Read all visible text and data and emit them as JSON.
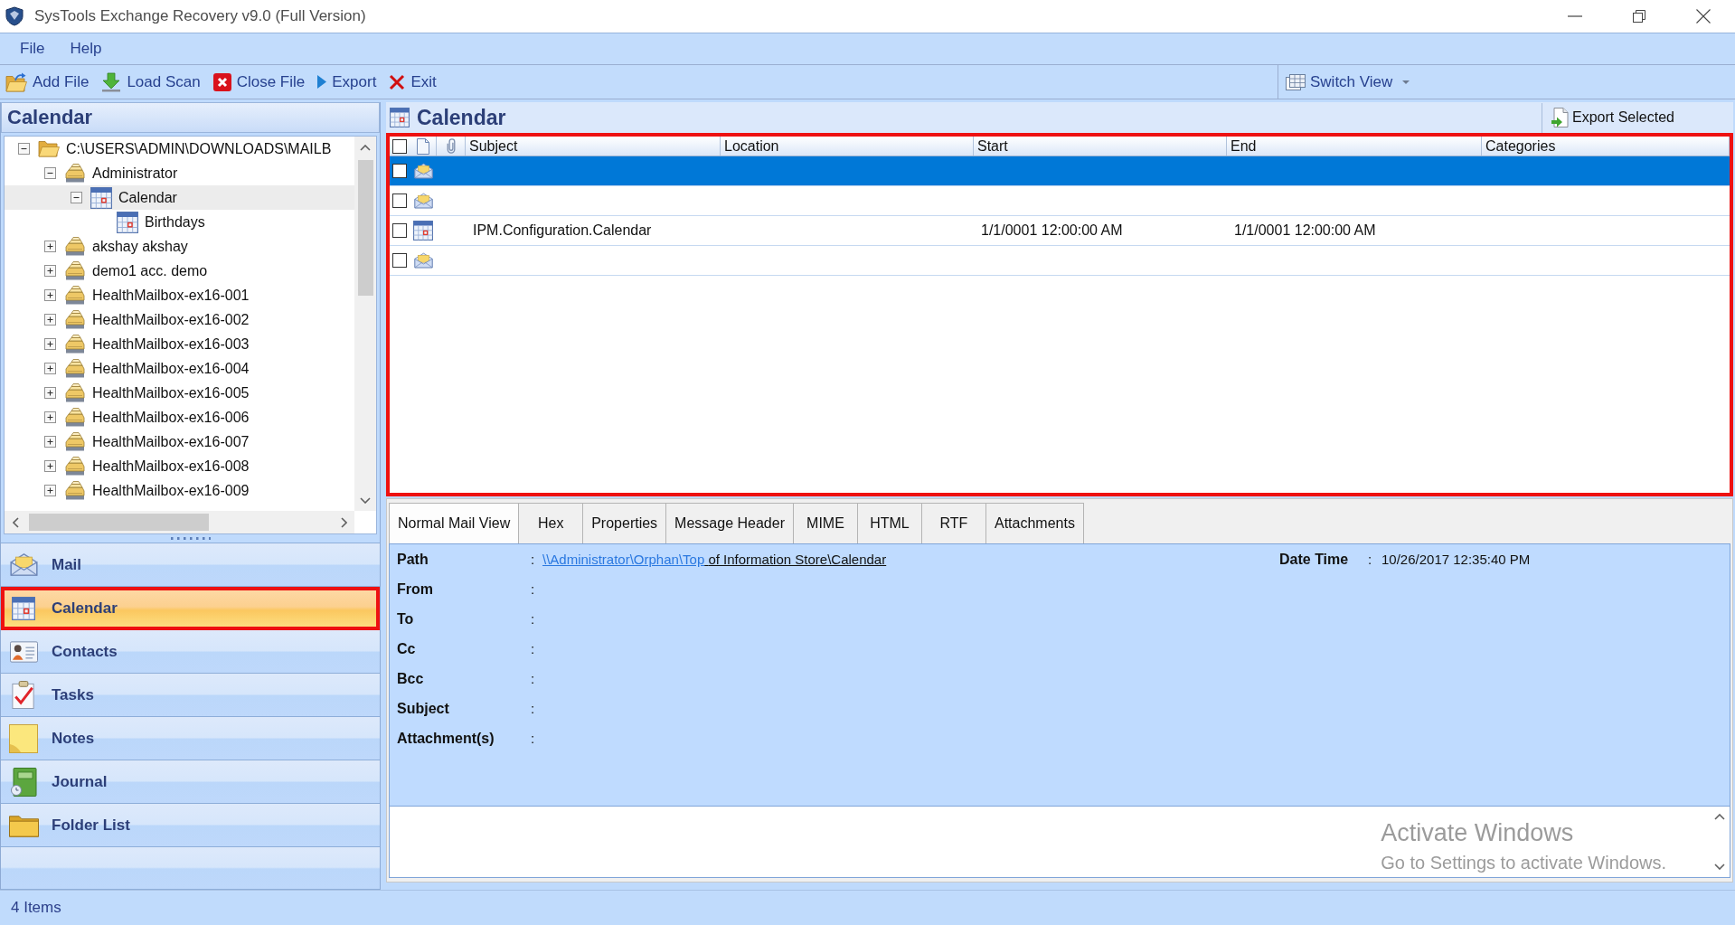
{
  "window": {
    "title": "SysTools Exchange Recovery v9.0 (Full Version)"
  },
  "menu": [
    "File",
    "Help"
  ],
  "toolbar": {
    "items": [
      {
        "kind": "add",
        "label": "Add File"
      },
      {
        "kind": "load",
        "label": "Load Scan"
      },
      {
        "kind": "close",
        "label": "Close File"
      },
      {
        "kind": "export",
        "label": "Export"
      },
      {
        "kind": "exit",
        "label": "Exit"
      }
    ],
    "switch_view": {
      "label": "Switch View"
    }
  },
  "left_panel": {
    "title": "Calendar",
    "tree": [
      {
        "kind": "folder",
        "label": "C:\\USERS\\ADMIN\\DOWNLOADS\\MAILB",
        "expanded": true,
        "selected": false,
        "children": [
          {
            "kind": "mailbox",
            "label": "Administrator",
            "expanded": true,
            "selected": false,
            "children": [
              {
                "kind": "calendar",
                "label": "Calendar",
                "expanded": true,
                "selected": true,
                "children": [
                  {
                    "kind": "calendar",
                    "label": "Birthdays",
                    "selected": false
                  }
                ]
              }
            ]
          },
          {
            "kind": "mailbox",
            "label": "akshay akshay",
            "expanded": false,
            "selected": false
          },
          {
            "kind": "mailbox",
            "label": "demo1 acc. demo",
            "expanded": false,
            "selected": false
          },
          {
            "kind": "mailbox",
            "label": "HealthMailbox-ex16-001",
            "expanded": false,
            "selected": false
          },
          {
            "kind": "mailbox",
            "label": "HealthMailbox-ex16-002",
            "expanded": false,
            "selected": false
          },
          {
            "kind": "mailbox",
            "label": "HealthMailbox-ex16-003",
            "expanded": false,
            "selected": false
          },
          {
            "kind": "mailbox",
            "label": "HealthMailbox-ex16-004",
            "expanded": false,
            "selected": false
          },
          {
            "kind": "mailbox",
            "label": "HealthMailbox-ex16-005",
            "expanded": false,
            "selected": false
          },
          {
            "kind": "mailbox",
            "label": "HealthMailbox-ex16-006",
            "expanded": false,
            "selected": false
          },
          {
            "kind": "mailbox",
            "label": "HealthMailbox-ex16-007",
            "expanded": false,
            "selected": false
          },
          {
            "kind": "mailbox",
            "label": "HealthMailbox-ex16-008",
            "expanded": false,
            "selected": false
          },
          {
            "kind": "mailbox",
            "label": "HealthMailbox-ex16-009",
            "expanded": false,
            "selected": false
          }
        ]
      }
    ]
  },
  "navigation": [
    {
      "kind": "mail",
      "label": "Mail",
      "selected": false,
      "highlighted": false
    },
    {
      "kind": "calendar",
      "label": "Calendar",
      "selected": true,
      "highlighted": true
    },
    {
      "kind": "contacts",
      "label": "Contacts",
      "selected": false,
      "highlighted": false
    },
    {
      "kind": "tasks",
      "label": "Tasks",
      "selected": false,
      "highlighted": false
    },
    {
      "kind": "notes",
      "label": "Notes",
      "selected": false,
      "highlighted": false
    },
    {
      "kind": "journal",
      "label": "Journal",
      "selected": false,
      "highlighted": false
    },
    {
      "kind": "folders",
      "label": "Folder List",
      "selected": false,
      "highlighted": false
    }
  ],
  "content": {
    "title": "Calendar",
    "export_button": {
      "label": "Export Selected"
    },
    "table": {
      "highlighted": true,
      "all_checked": false,
      "columns": {
        "subject": "Subject",
        "location": "Location",
        "start": "Start",
        "end": "End",
        "categories": "Categories"
      },
      "rows": [
        {
          "kind": "mail",
          "selected": true,
          "checked": false
        },
        {
          "kind": "mail",
          "selected": false,
          "checked": false
        },
        {
          "kind": "calendar",
          "selected": false,
          "checked": false,
          "subject": "IPM.Configuration.Calendar",
          "start": "1/1/0001 12:00:00 AM",
          "end": "1/1/0001 12:00:00 AM"
        },
        {
          "kind": "mail",
          "selected": false,
          "checked": false
        }
      ]
    },
    "tabs": [
      {
        "label": "Normal Mail View",
        "selected": true
      },
      {
        "label": "Hex",
        "selected": false
      },
      {
        "label": "Properties",
        "selected": false
      },
      {
        "label": "Message Header",
        "selected": false
      },
      {
        "label": "MIME",
        "selected": false
      },
      {
        "label": "HTML",
        "selected": false
      },
      {
        "label": "RTF",
        "selected": false
      },
      {
        "label": "Attachments",
        "selected": false
      }
    ],
    "preview": {
      "fields": [
        {
          "label": "Path",
          "separator": ":",
          "link": "\\\\Administrator\\Orphan\\Top",
          "value": "of Information Store\\Calendar"
        },
        {
          "label": "From",
          "separator": ":"
        },
        {
          "label": "To",
          "separator": ":"
        },
        {
          "label": "Cc",
          "separator": ":"
        },
        {
          "label": "Bcc",
          "separator": ":"
        },
        {
          "label": "Subject",
          "separator": ":"
        },
        {
          "label": "Attachment(s)",
          "separator": ":"
        }
      ],
      "date_time": {
        "label": "Date Time",
        "separator": ":",
        "value": "10/26/2017 12:35:40 PM"
      },
      "windows_notice": {
        "title": "Activate Windows",
        "text": "Go to Settings to activate Windows."
      }
    }
  },
  "status_bar": {
    "text": "4 Items"
  }
}
